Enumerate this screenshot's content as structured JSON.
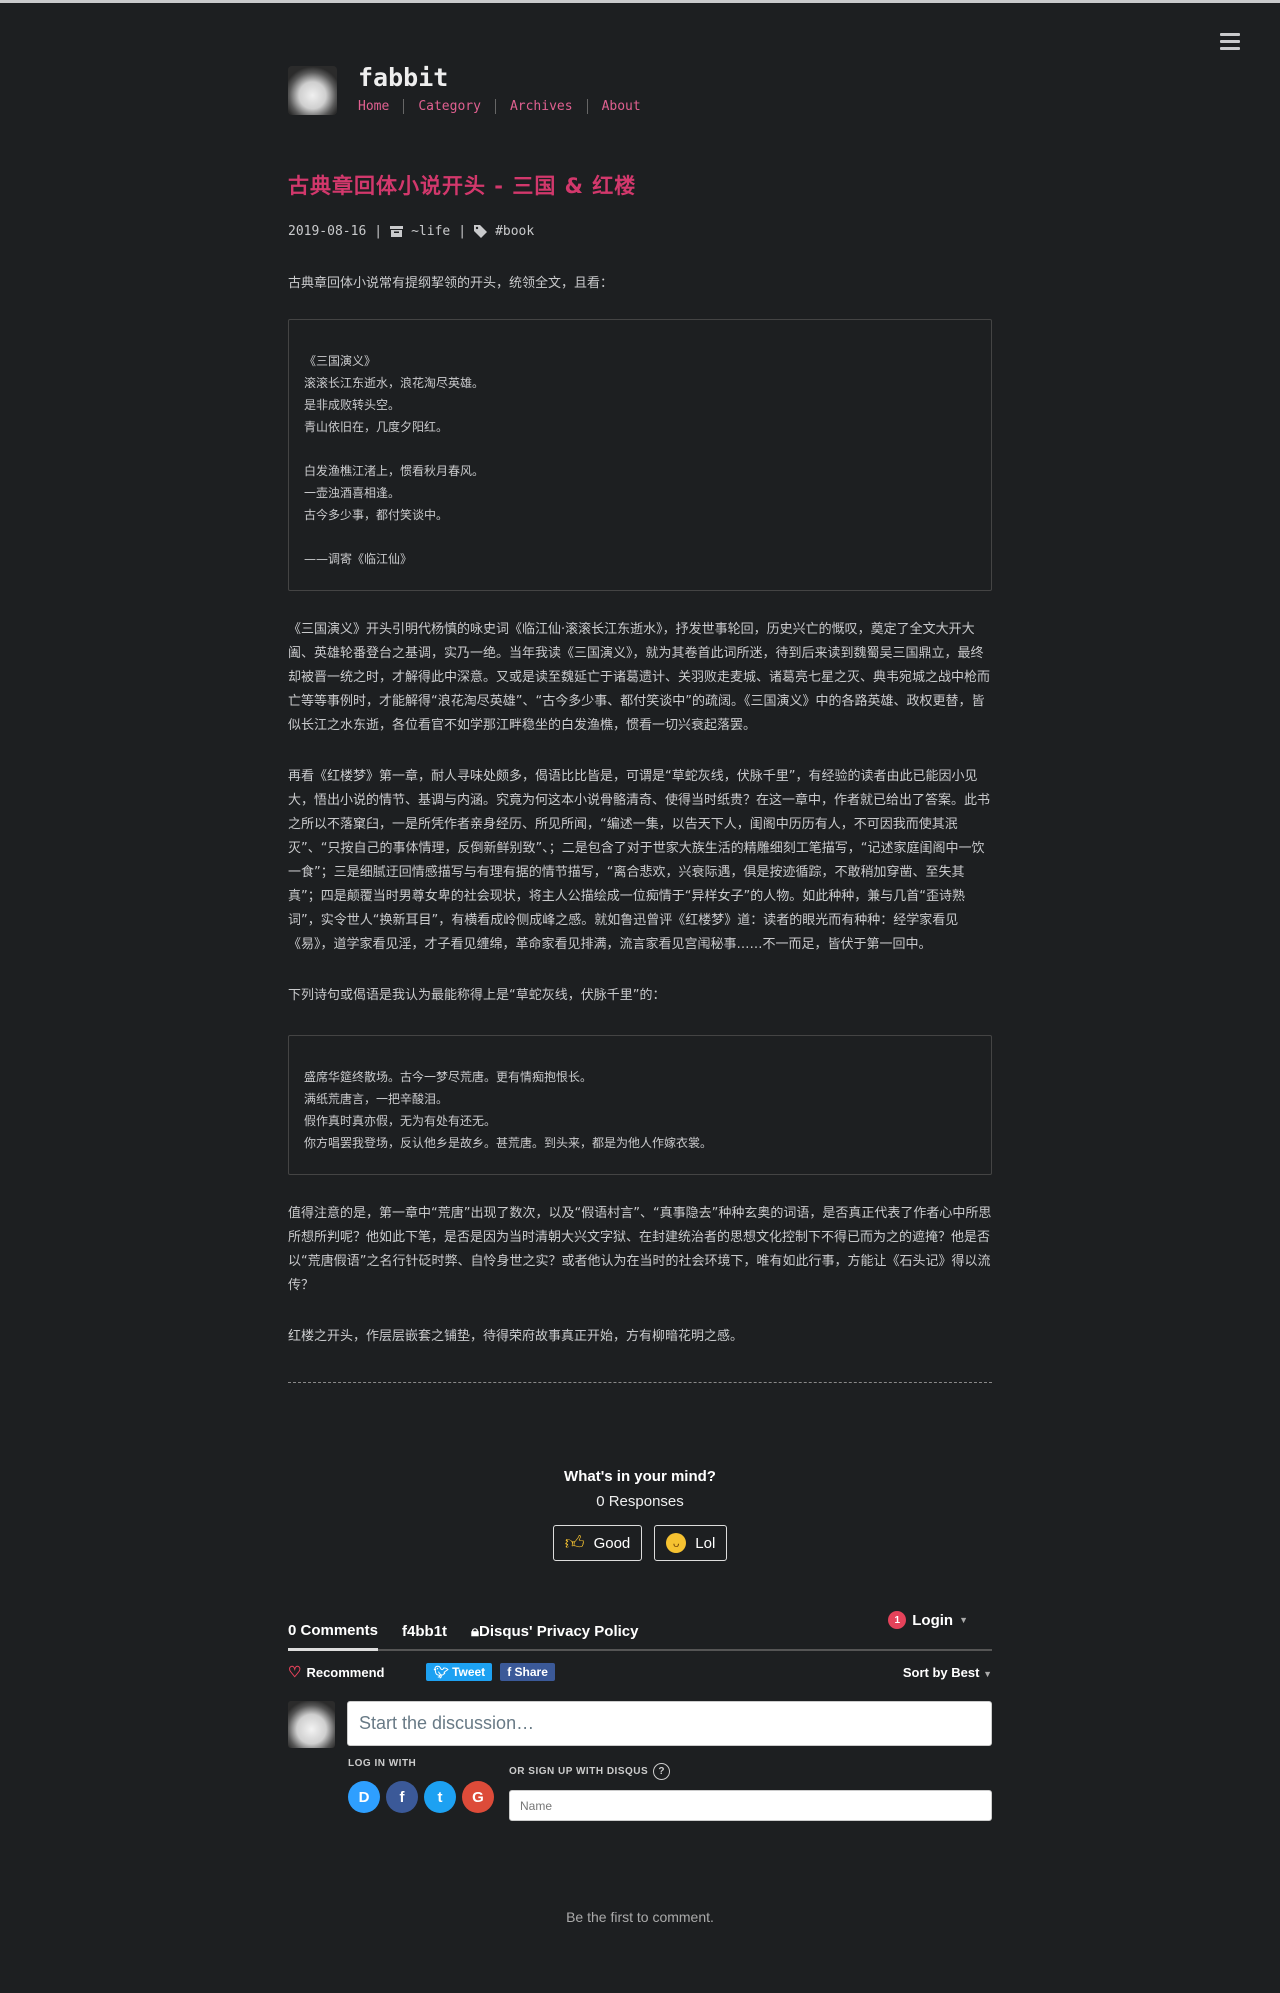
{
  "site": {
    "title": "fabbit",
    "nav": [
      "Home",
      "Category",
      "Archives",
      "About"
    ]
  },
  "post": {
    "title": "古典章回体小说开头 - 三国 & 红楼",
    "date": "2019-08-16",
    "category": "~life",
    "tag": "#book",
    "intro": "古典章回体小说常有提纲挈领的开头，统领全文，且看：",
    "poem1": "《三国演义》\n滚滚长江东逝水，浪花淘尽英雄。\n是非成败转头空。\n青山依旧在，几度夕阳红。\n\n白发渔樵江渚上，惯看秋月春风。\n一壶浊酒喜相逢。\n古今多少事，都付笑谈中。\n\n        ——调寄《临江仙》",
    "p1": "《三国演义》开头引明代杨慎的咏史词《临江仙·滚滚长江东逝水》，抒发世事轮回，历史兴亡的慨叹，奠定了全文大开大阖、英雄轮番登台之基调，实乃一绝。当年我读《三国演义》，就为其卷首此词所迷，待到后来读到魏蜀吴三国鼎立，最终却被晋一统之时，才解得此中深意。又或是读至魏延亡于诸葛遗计、关羽败走麦城、诸葛亮七星之灭、典韦宛城之战中枪而亡等等事例时，才能解得“浪花淘尽英雄”、“古今多少事、都付笑谈中”的疏阔。《三国演义》中的各路英雄、政权更替，皆似长江之水东逝，各位看官不如学那江畔稳坐的白发渔樵，惯看一切兴衰起落罢。",
    "p2": "再看《红楼梦》第一章，耐人寻味处颇多，偈语比比皆是，可谓是“草蛇灰线，伏脉千里”，有经验的读者由此已能因小见大，悟出小说的情节、基调与内涵。究竟为何这本小说骨骼清奇、使得当时纸贵？在这一章中，作者就已给出了答案。此书之所以不落窠臼，一是所凭作者亲身经历、所见所闻，“编述一集，以告天下人，闺阁中历历有人，不可因我而使其泯灭”、“只按自己的事体情理，反倒新鲜别致”、；二是包含了对于世家大族生活的精雕细刻工笔描写，“记述家庭闺阁中一饮一食”；三是细腻迂回情感描写与有理有据的情节描写，“离合悲欢，兴衰际遇，俱是按迹循踪，不敢稍加穿凿、至失其真”；四是颠覆当时男尊女卑的社会现状，将主人公描绘成一位痴情于“异样女子”的人物。如此种种，兼与几首“歪诗熟词”，实令世人“换新耳目”，有横看成岭侧成峰之感。就如鲁迅曾评《红楼梦》道：读者的眼光而有种种：经学家看见《易》，道学家看见淫，才子看见缠绵，革命家看见排满，流言家看见宫闱秘事……不一而足，皆伏于第一回中。",
    "p3": "下列诗句或偈语是我认为最能称得上是“草蛇灰线，伏脉千里”的：",
    "poem2": "盛席华筵终散场。古今一梦尽荒唐。更有情痴抱恨长。\n满纸荒唐言，一把辛酸泪。\n假作真时真亦假，无为有处有还无。\n你方唱罢我登场，反认他乡是故乡。甚荒唐。到头来，都是为他人作嫁衣裳。",
    "p4": "值得注意的是，第一章中“荒唐”出现了数次，以及“假语村言”、“真事隐去”种种玄奥的词语，是否真正代表了作者心中所思所想所判呢？他如此下笔，是否是因为当时清朝大兴文字狱、在封建统治者的思想文化控制下不得已而为之的遮掩？他是否以“荒唐假语”之名行针砭时弊、自怜身世之实？或者他认为在当时的社会环境下，唯有如此行事，方能让《石头记》得以流传？",
    "p5": "红楼之开头，作层层嵌套之铺垫，待得荣府故事真正开始，方有柳暗花明之感。"
  },
  "reactions": {
    "question": "What's in your mind?",
    "count": "0 Responses",
    "good": "Good",
    "lol": "Lol"
  },
  "disqus": {
    "comments_tab": "0 Comments",
    "site_tab": "f4bb1t",
    "privacy_tab": "Disqus' Privacy Policy",
    "notif_count": "1",
    "login": "Login",
    "recommend": "Recommend",
    "tweet": "Tweet",
    "share": "Share",
    "sort": "Sort by Best",
    "placeholder": "Start the discussion…",
    "log_in_with": "LOG IN WITH",
    "signup": "OR SIGN UP WITH DISQUS",
    "name_placeholder": "Name",
    "first": "Be the first to comment."
  }
}
